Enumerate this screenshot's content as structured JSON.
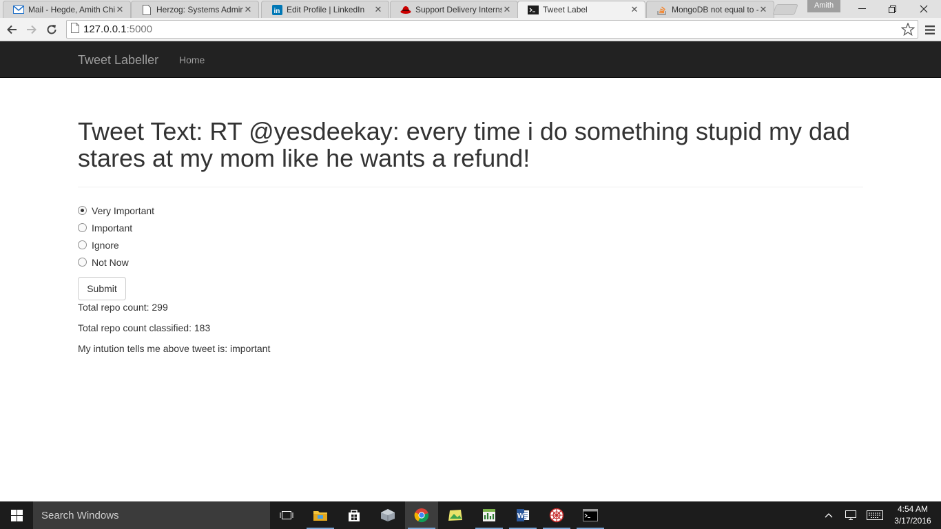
{
  "browser": {
    "tabs": [
      {
        "title": "Mail - Hegde, Amith Chit",
        "icon": "mail-icon",
        "active": false
      },
      {
        "title": "Herzog: Systems Admini",
        "icon": "page-icon",
        "active": false
      },
      {
        "title": "Edit Profile | LinkedIn",
        "icon": "linkedin-icon",
        "active": false
      },
      {
        "title": "Support Delivery Interns",
        "icon": "redhat-icon",
        "active": false
      },
      {
        "title": "Tweet Label",
        "icon": "terminal-icon",
        "active": true
      },
      {
        "title": "MongoDB not equal to - ",
        "icon": "stackoverflow-icon",
        "active": false
      }
    ],
    "profile_name": "Amith",
    "url_host": "127.0.0.1",
    "url_port": ":5000"
  },
  "navbar": {
    "brand": "Tweet Labeller",
    "links": [
      "Home"
    ]
  },
  "main": {
    "tweet_heading": "Tweet Text: RT @yesdeekay: every time i do something stupid my dad stares at my mom like he wants a refund!",
    "options": [
      {
        "label": "Very Important",
        "checked": true
      },
      {
        "label": "Important",
        "checked": false
      },
      {
        "label": "Ignore",
        "checked": false
      },
      {
        "label": "Not Now",
        "checked": false
      }
    ],
    "submit_label": "Submit",
    "total_count": "Total repo count: 299",
    "classified_count": "Total repo count classified: 183",
    "intuition": "My intution tells me above tweet is: important"
  },
  "taskbar": {
    "search_placeholder": "Search Windows",
    "time": "4:54 AM",
    "date": "3/17/2016"
  },
  "colors": {
    "navbar_bg": "#222222",
    "navbar_text": "#9d9d9d",
    "taskbar_bg": "#1c1c1c"
  }
}
